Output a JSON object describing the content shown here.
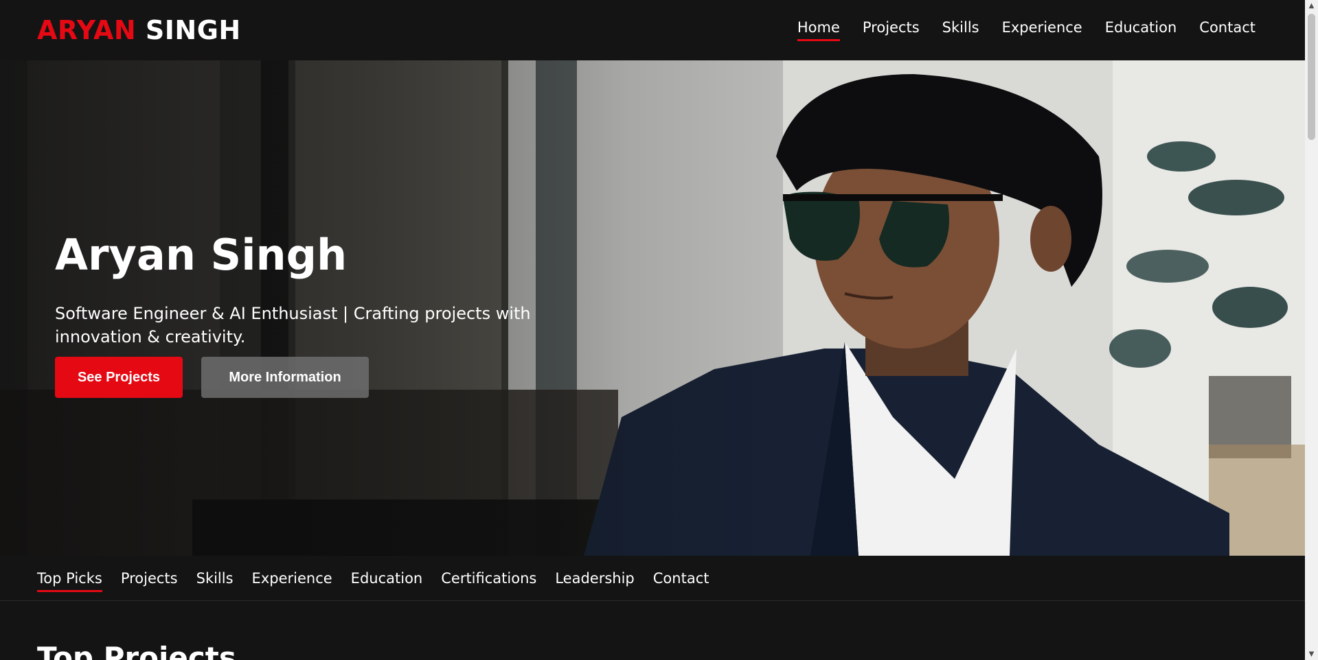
{
  "navbar": {
    "logo_first": "ARYAN",
    "logo_second": "SINGH",
    "links": [
      "Home",
      "Projects",
      "Skills",
      "Experience",
      "Education",
      "Contact"
    ],
    "active_index": 0
  },
  "hero": {
    "title": "Aryan Singh",
    "description": "Software Engineer & AI Enthusiast | Crafting projects with innovation & creativity.",
    "primary_button": "See Projects",
    "secondary_button": "More Information"
  },
  "subnav": {
    "links": [
      "Top Picks",
      "Projects",
      "Skills",
      "Experience",
      "Education",
      "Certifications",
      "Leadership",
      "Contact"
    ],
    "active_index": 0
  },
  "section": {
    "title": "Top Projects"
  },
  "colors": {
    "accent": "#e50914",
    "background": "#141414",
    "secondary_button": "#6d6d6e"
  }
}
